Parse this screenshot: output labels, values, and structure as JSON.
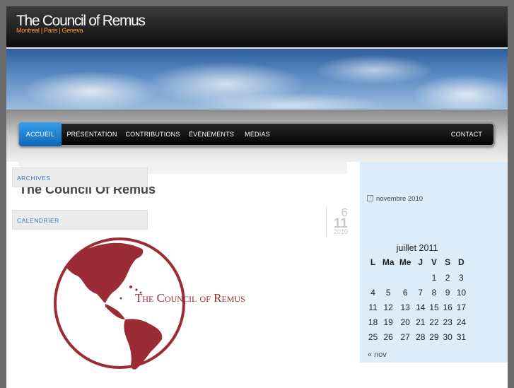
{
  "site": {
    "title": "The Council of Remus",
    "tagline": "Montreal | Paris | Geneva"
  },
  "nav": {
    "items": [
      {
        "label": "ACCUEIL",
        "active": true
      },
      {
        "label": "PRÉSENTATION"
      },
      {
        "label": "CONTRIBUTIONS"
      },
      {
        "label": "ÉVÉNEMENTS"
      },
      {
        "label": "MÉDIAS"
      }
    ],
    "contact": "CONTACT"
  },
  "post": {
    "title": "The Council Of Remus",
    "date": {
      "day": "6",
      "month": "11",
      "year": "2010"
    },
    "logo_text": "The Council of Remus",
    "logo_color": "#9b2b35"
  },
  "sidebar": {
    "archives_title": "ARCHIVES",
    "archive_links": [
      "novembre 2010"
    ],
    "calendar_title": "CALENDRIER",
    "calendar": {
      "caption": "juillet 2011",
      "weekdays": [
        "L",
        "Ma",
        "Me",
        "J",
        "V",
        "S",
        "D"
      ],
      "weeks": [
        [
          "",
          "",
          "",
          "",
          "1",
          "2",
          "3"
        ],
        [
          "4",
          "5",
          "6",
          "7",
          "8",
          "9",
          "10"
        ],
        [
          "11",
          "12",
          "13",
          "14",
          "15",
          "16",
          "17"
        ],
        [
          "18",
          "19",
          "20",
          "21",
          "22",
          "23",
          "24"
        ],
        [
          "25",
          "26",
          "27",
          "28",
          "29",
          "30",
          "31"
        ]
      ],
      "prev": "« nov"
    }
  },
  "colors": {
    "accent": "#2a7cc7",
    "tagline": "#ff9a2a",
    "sidebar_bg": "#dcecf8"
  }
}
